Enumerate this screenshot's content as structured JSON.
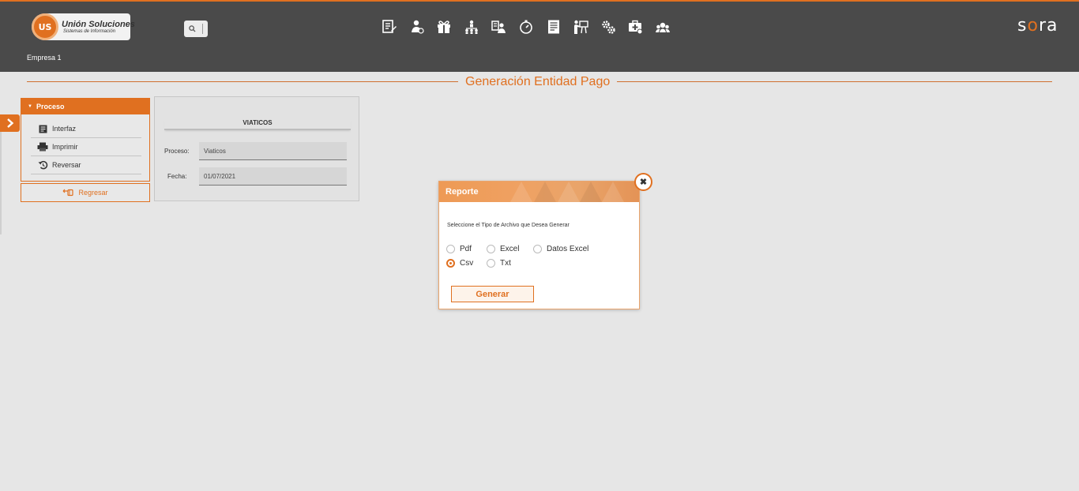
{
  "header": {
    "logo_text": "Unión Soluciones",
    "logo_subtext": "Sistemas de Información",
    "logo_badge": "US",
    "company": "Empresa 1",
    "brand_pre": "s",
    "brand_mid": "o",
    "brand_post": "ra",
    "menu_icons": [
      "document-edit-icon",
      "user-money-icon",
      "gift-icon",
      "org-chart-icon",
      "user-doc-icon",
      "timer-icon",
      "report-icon",
      "presentation-icon",
      "gears-icon",
      "medical-kit-icon",
      "group-icon"
    ]
  },
  "page": {
    "title": "Generación Entidad Pago"
  },
  "sidebar": {
    "header": "Proceso",
    "items": [
      {
        "label": "Interfaz",
        "icon": "list-icon"
      },
      {
        "label": "Imprimir",
        "icon": "printer-icon"
      },
      {
        "label": "Reversar",
        "icon": "undo-icon"
      }
    ],
    "back_label": "Regresar"
  },
  "form": {
    "title": "VIATICOS",
    "process_label": "Proceso:",
    "process_value": "Viaticos",
    "date_label": "Fecha:",
    "date_value": "01/07/2021"
  },
  "dialog": {
    "title": "Reporte",
    "message": "Seleccione el Tipo de Archivo que Desea Generar",
    "options": [
      "Pdf",
      "Excel",
      "Datos Excel",
      "Csv",
      "Txt"
    ],
    "selected": "Csv",
    "generate_label": "Generar"
  },
  "colors": {
    "accent": "#e07020",
    "header_bg": "#4a4a4a",
    "page_bg": "#e6e6e6"
  }
}
